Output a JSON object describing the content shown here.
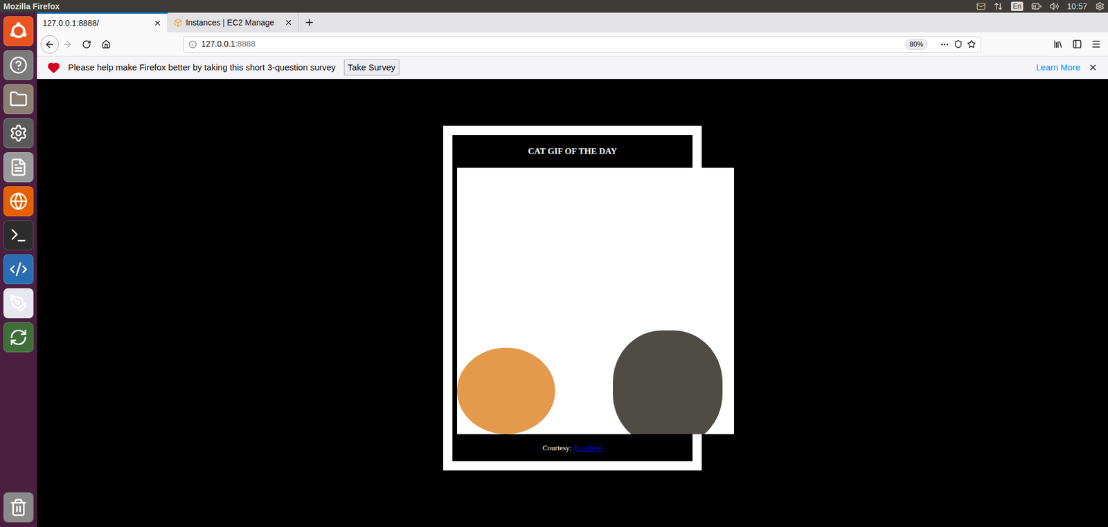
{
  "system_bar": {
    "title": "Mozilla Firefox",
    "keyboard": "En",
    "time": "10:57"
  },
  "tabs": [
    {
      "label": "127.0.0.1:8888/",
      "selected": true
    },
    {
      "label": "Instances | EC2 Manage",
      "selected": false
    }
  ],
  "address_bar": {
    "url_host": "127.0.0.1",
    "url_port": ":8888",
    "zoom": "80%"
  },
  "notification": {
    "message": "Please help make Firefox better by taking this short 3-question survey",
    "button": "Take Survey",
    "link": "Learn More"
  },
  "page": {
    "title": "CAT GIF OF THE DAY",
    "credit_label": "Courtesy:",
    "credit_link": "Buzzfeed"
  }
}
